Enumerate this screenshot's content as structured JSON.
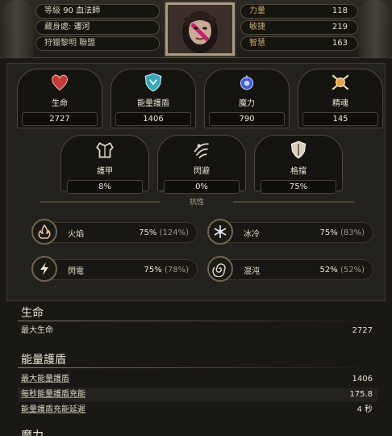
{
  "header": {
    "level_label": "等級",
    "level": "90",
    "class": "血法師",
    "hideout_label": "藏身處:",
    "hideout": "運河",
    "guild": "狩獵黎明 聯盟",
    "attributes": [
      {
        "label": "力量",
        "value": "118"
      },
      {
        "label": "敏捷",
        "value": "219"
      },
      {
        "label": "智慧",
        "value": "163"
      }
    ]
  },
  "stats_top": [
    {
      "label": "生命",
      "value": "2727",
      "icon": "heart-icon"
    },
    {
      "label": "能量護盾",
      "value": "1406",
      "icon": "energy-shield-icon"
    },
    {
      "label": "魔力",
      "value": "790",
      "icon": "mana-icon"
    },
    {
      "label": "精魂",
      "value": "145",
      "icon": "spirit-icon"
    }
  ],
  "stats_mid": [
    {
      "label": "護甲",
      "value": "8%",
      "icon": "armour-icon"
    },
    {
      "label": "閃避",
      "value": "0%",
      "icon": "evasion-icon"
    },
    {
      "label": "格擋",
      "value": "75%",
      "icon": "block-shield-icon"
    }
  ],
  "resist_title": "抗性",
  "resists": [
    {
      "label": "火焰",
      "value": "75%",
      "cap": "(124%)",
      "icon": "fire-icon"
    },
    {
      "label": "冰冷",
      "value": "75%",
      "cap": "(83%)",
      "icon": "cold-icon"
    },
    {
      "label": "閃電",
      "value": "75%",
      "cap": "(78%)",
      "icon": "lightning-icon"
    },
    {
      "label": "混沌",
      "value": "52%",
      "cap": "(52%)",
      "icon": "chaos-icon"
    }
  ],
  "details": {
    "life_title": "生命",
    "max_life_label": "最大生命",
    "max_life": "2727",
    "es_title": "能量護盾",
    "es_rows": [
      {
        "label": "最大能量護盾",
        "value": "1406"
      },
      {
        "label": "每秒能量護盾充能",
        "value": "175.8"
      },
      {
        "label": "能量護盾充能延遲",
        "value": "4 秒"
      }
    ],
    "next_title": "魔力"
  },
  "colors": {
    "gold": "#c9a96d",
    "text": "#e9e2d0",
    "background": "#1b1916"
  }
}
